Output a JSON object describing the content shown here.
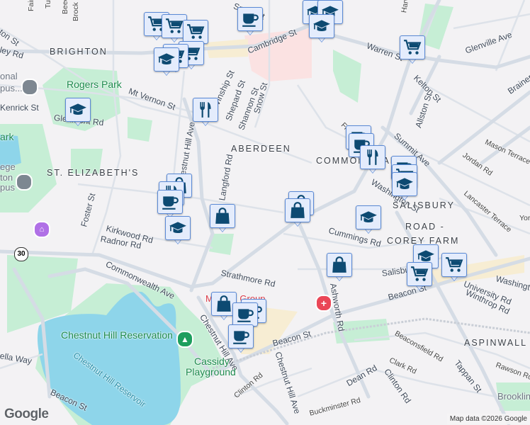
{
  "map": {
    "labels": [
      "Fairbank",
      "Turn",
      "Beechcr",
      "Brock St",
      "ton St",
      "ley Rd",
      "BRIGHTON",
      "onal",
      "pus...",
      "Rogers Park",
      "Mt Vernon St",
      "Kenrick St",
      "Glenmont Rd",
      "ark",
      "ege",
      "ton",
      "pus",
      "ST. ELIZABETH'S",
      "Winship St",
      "Shepard St",
      "Shannon St",
      "Snow St",
      "Chestnut Hill Ave",
      "Langford Rd",
      "ABERDEEN",
      "Cambridge St",
      "Warren St",
      "Kelton St",
      "Allston St",
      "Glenville Ave",
      "Brainerd Rd",
      "Fidelis Way",
      "COMMONWEALTH",
      "Summit Ave",
      "Mason Terrace",
      "Jordan Rd",
      "Lancaster Terrace",
      "Washington St",
      "Foster St",
      "Kirkwood Rd",
      "Radnor Rd",
      "Commonwealth Ave",
      "Strathmore Rd",
      "Chestnut Hill Ave",
      "Chestnut Hill Reservation",
      "Chestnut Hill Reservoir",
      "ella Way",
      "Cassidy",
      "Playground",
      "Beacon St",
      "Clinton Rd",
      "Chestnut Hill Ave",
      "Beacon St",
      "Beacon St",
      "SALISBURY",
      "ROAD -",
      "COREY FARM",
      "Cummings Rd",
      "Salisbury Rd",
      "Ashworth Rd",
      "Medical Group",
      "University Rd",
      "Winthrop Rd",
      "Washington St",
      "ASPINWALL HILL",
      "Beaconsfield Rd",
      "Clark Rd",
      "Tappan St",
      "Rawson Rd",
      "Dean Rd",
      "Clinton Rd",
      "Buckminster Rd",
      "Brookline",
      "York",
      "Spark St",
      "Harvard Ave"
    ],
    "route_shield": "30",
    "markers": [
      "cart",
      "cart",
      "cart",
      "cart",
      "cart",
      "cap",
      "cup",
      "cap",
      "cap",
      "cap",
      "cart",
      "cap",
      "fork",
      "cup",
      "cup",
      "fork",
      "cup",
      "cart",
      "cap",
      "bag",
      "fork",
      "cup",
      "bag",
      "cap",
      "bag",
      "bag",
      "cap",
      "bag",
      "cap",
      "cart",
      "cart",
      "bag",
      "cup",
      "cup",
      "cup"
    ],
    "logo": "Google",
    "attribution": "Map data ©2026 Google"
  },
  "colors": {
    "background": "#f3f2f4",
    "road": "#d5dce5",
    "park": "#c6eed5",
    "water": "#8ed5ea",
    "marker_fill": "#e4ecfc",
    "marker_border": "#5b8ad6",
    "icon": "#0d4a72"
  }
}
